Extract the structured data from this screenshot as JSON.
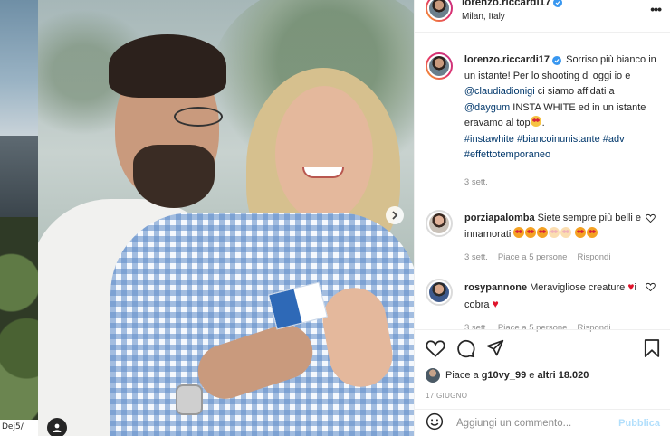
{
  "left_strip": {
    "handle_text": "Dej5/"
  },
  "header": {
    "username": "lorenzo.riccardi17",
    "location": "Milan, Italy",
    "more_icon": "more-horizontal-icon"
  },
  "caption": {
    "username": "lorenzo.riccardi17",
    "text_1": " Sorriso più bianco in un istante! Per lo shooting di oggi io e ",
    "mention_1": "@claudiadionigi",
    "text_2": " ci siamo affidati a ",
    "mention_2": "@daygum",
    "text_3": " INSTA WHITE ed in un istante eravamo al top",
    "hashtags": "#instawhite #biancoinunistante #adv #effettotemporaneo",
    "time": "3 sett."
  },
  "comments": [
    {
      "username": "porziapalomba",
      "text": " Siete sempre più belli e innamorati ",
      "time": "3 sett.",
      "likes": "Piace a 5 persone",
      "reply": "Rispondi"
    },
    {
      "username": "rosypannone",
      "text_1": " Meravigliose creature ",
      "text_2": "i cobra ",
      "time": "3 sett.",
      "likes": "Piace a 5 persone",
      "reply": "Rispondi"
    }
  ],
  "likes": {
    "prefix": "Piace a ",
    "user": "g10vy_99",
    "middle": " e ",
    "others": "altri 18.020"
  },
  "date": "17 GIUGNO",
  "add_comment": {
    "placeholder": "Aggiungi un commento...",
    "publish_label": "Pubblica"
  },
  "colors": {
    "link": "#00376b",
    "verified": "#3897f0",
    "muted": "#8e8e8e",
    "publish_disabled": "#b2dffc",
    "heart": "#e0142b"
  }
}
